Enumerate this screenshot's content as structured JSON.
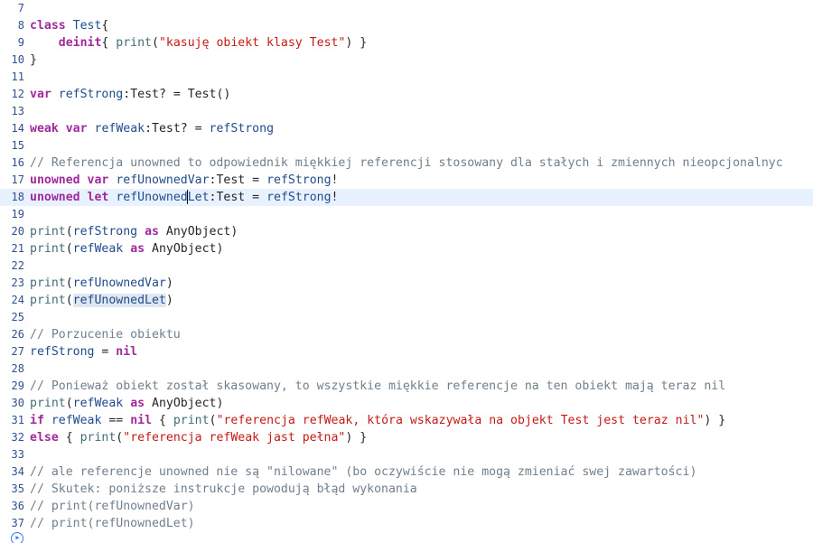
{
  "editor": {
    "current_line": 18,
    "lines": [
      {
        "n": "7",
        "tokens": []
      },
      {
        "n": "8",
        "tokens": [
          {
            "t": "class",
            "c": "kw"
          },
          {
            "t": " "
          },
          {
            "t": "Test",
            "c": "id"
          },
          {
            "t": "{"
          }
        ]
      },
      {
        "n": "9",
        "tokens": [
          {
            "t": "    "
          },
          {
            "t": "deinit",
            "c": "kw"
          },
          {
            "t": "{ "
          },
          {
            "t": "print",
            "c": "fn"
          },
          {
            "t": "("
          },
          {
            "t": "\"kasuję obiekt klasy Test\"",
            "c": "str"
          },
          {
            "t": ") }"
          }
        ]
      },
      {
        "n": "10",
        "tokens": [
          {
            "t": "}"
          }
        ]
      },
      {
        "n": "11",
        "tokens": []
      },
      {
        "n": "12",
        "tokens": [
          {
            "t": "var",
            "c": "kw"
          },
          {
            "t": " "
          },
          {
            "t": "refStrong",
            "c": "id"
          },
          {
            "t": ":Test? = Test()"
          }
        ]
      },
      {
        "n": "13",
        "tokens": []
      },
      {
        "n": "14",
        "tokens": [
          {
            "t": "weak",
            "c": "kw"
          },
          {
            "t": " "
          },
          {
            "t": "var",
            "c": "kw"
          },
          {
            "t": " "
          },
          {
            "t": "refWeak",
            "c": "id"
          },
          {
            "t": ":Test? = "
          },
          {
            "t": "refStrong",
            "c": "id"
          }
        ]
      },
      {
        "n": "15",
        "tokens": []
      },
      {
        "n": "16",
        "tokens": [
          {
            "t": "// Referencja unowned to odpowiednik miękkiej referencji stosowany dla stałych i zmiennych nieopcjonalnyc",
            "c": "cm"
          }
        ]
      },
      {
        "n": "17",
        "tokens": [
          {
            "t": "unowned",
            "c": "kw"
          },
          {
            "t": " "
          },
          {
            "t": "var",
            "c": "kw"
          },
          {
            "t": " "
          },
          {
            "t": "refUnownedVar",
            "c": "id"
          },
          {
            "t": ":Test = "
          },
          {
            "t": "refStrong",
            "c": "id"
          },
          {
            "t": "!"
          }
        ]
      },
      {
        "n": "18",
        "tokens": [
          {
            "t": "unowned",
            "c": "kw"
          },
          {
            "t": " "
          },
          {
            "t": "let",
            "c": "kw"
          },
          {
            "t": " "
          },
          {
            "t": "refUnowned",
            "c": "id"
          },
          {
            "caret": true
          },
          {
            "t": "Let",
            "c": "id"
          },
          {
            "t": ":Test = "
          },
          {
            "t": "refStrong",
            "c": "id"
          },
          {
            "t": "!"
          }
        ]
      },
      {
        "n": "19",
        "tokens": []
      },
      {
        "n": "20",
        "tokens": [
          {
            "t": "print",
            "c": "fn"
          },
          {
            "t": "("
          },
          {
            "t": "refStrong",
            "c": "id"
          },
          {
            "t": " "
          },
          {
            "t": "as",
            "c": "kw"
          },
          {
            "t": " AnyObject)"
          }
        ]
      },
      {
        "n": "21",
        "tokens": [
          {
            "t": "print",
            "c": "fn"
          },
          {
            "t": "("
          },
          {
            "t": "refWeak",
            "c": "id"
          },
          {
            "t": " "
          },
          {
            "t": "as",
            "c": "kw"
          },
          {
            "t": " AnyObject)"
          }
        ]
      },
      {
        "n": "22",
        "tokens": []
      },
      {
        "n": "23",
        "tokens": [
          {
            "t": "print",
            "c": "fn"
          },
          {
            "t": "("
          },
          {
            "t": "refUnownedVar",
            "c": "id"
          },
          {
            "t": ")"
          }
        ]
      },
      {
        "n": "24",
        "tokens": [
          {
            "t": "print",
            "c": "fn"
          },
          {
            "t": "("
          },
          {
            "t": "refUnownedLet",
            "c": "id hl"
          },
          {
            "t": ")"
          }
        ]
      },
      {
        "n": "25",
        "tokens": []
      },
      {
        "n": "26",
        "tokens": [
          {
            "t": "// Porzucenie obiektu",
            "c": "cm"
          }
        ]
      },
      {
        "n": "27",
        "tokens": [
          {
            "t": "refStrong",
            "c": "id"
          },
          {
            "t": " = "
          },
          {
            "t": "nil",
            "c": "kw"
          }
        ]
      },
      {
        "n": "28",
        "tokens": []
      },
      {
        "n": "29",
        "tokens": [
          {
            "t": "// Ponieważ obiekt został skasowany, to wszystkie miękkie referencje na ten obiekt mają teraz nil",
            "c": "cm"
          }
        ]
      },
      {
        "n": "30",
        "tokens": [
          {
            "t": "print",
            "c": "fn"
          },
          {
            "t": "("
          },
          {
            "t": "refWeak",
            "c": "id"
          },
          {
            "t": " "
          },
          {
            "t": "as",
            "c": "kw"
          },
          {
            "t": " AnyObject)"
          }
        ]
      },
      {
        "n": "31",
        "tokens": [
          {
            "t": "if",
            "c": "kw"
          },
          {
            "t": " "
          },
          {
            "t": "refWeak",
            "c": "id"
          },
          {
            "t": " == "
          },
          {
            "t": "nil",
            "c": "kw"
          },
          {
            "t": " { "
          },
          {
            "t": "print",
            "c": "fn"
          },
          {
            "t": "("
          },
          {
            "t": "\"referencja refWeak, która wskazywała na objekt Test jest teraz nil\"",
            "c": "str"
          },
          {
            "t": ") }"
          }
        ]
      },
      {
        "n": "32",
        "tokens": [
          {
            "t": "else",
            "c": "kw"
          },
          {
            "t": " { "
          },
          {
            "t": "print",
            "c": "fn"
          },
          {
            "t": "("
          },
          {
            "t": "\"referencja refWeak jast pełna\"",
            "c": "str"
          },
          {
            "t": ") }"
          }
        ]
      },
      {
        "n": "33",
        "tokens": []
      },
      {
        "n": "34",
        "tokens": [
          {
            "t": "// ale referencje unowned nie są \"nilowane\" (bo oczywiście nie mogą zmieniać swej zawartości)",
            "c": "cm"
          }
        ]
      },
      {
        "n": "35",
        "tokens": [
          {
            "t": "// Skutek: poniższe instrukcje powodują błąd wykonania",
            "c": "cm"
          }
        ]
      },
      {
        "n": "36",
        "tokens": [
          {
            "t": "// print(refUnownedVar)",
            "c": "cm"
          }
        ]
      },
      {
        "n": "37",
        "tokens": [
          {
            "t": "// print(refUnownedLet)",
            "c": "cm"
          }
        ]
      }
    ]
  },
  "run_button": {
    "icon": "play-icon",
    "glyph": "▶"
  },
  "colors": {
    "keyword": "#a1299c",
    "string": "#c41a16",
    "function": "#3f6e74",
    "identifier": "#1f4b8c",
    "comment": "#707f8c",
    "current_line": "#e8f2ff",
    "accent": "#3478f6"
  }
}
